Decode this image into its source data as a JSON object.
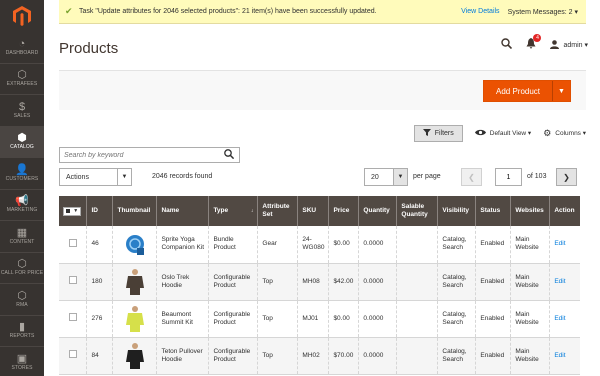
{
  "sidebar": {
    "items": [
      {
        "label": "DASHBOARD",
        "icon": "dashboard-icon",
        "glyph": "◔"
      },
      {
        "label": "EXTRAFEES",
        "icon": "extrafees-icon",
        "glyph": "⬡"
      },
      {
        "label": "SALES",
        "icon": "dollar-icon",
        "glyph": "$"
      },
      {
        "label": "CATALOG",
        "icon": "catalog-cube-icon",
        "glyph": "⬢"
      },
      {
        "label": "CUSTOMERS",
        "icon": "customer-icon",
        "glyph": "👤"
      },
      {
        "label": "MARKETING",
        "icon": "megaphone-icon",
        "glyph": "📢"
      },
      {
        "label": "CONTENT",
        "icon": "content-icon",
        "glyph": "▦"
      },
      {
        "label": "CALL FOR PRICE",
        "icon": "call-for-price-icon",
        "glyph": "⬡"
      },
      {
        "label": "RMA",
        "icon": "rma-icon",
        "glyph": "⬡"
      },
      {
        "label": "REPORTS",
        "icon": "reports-icon",
        "glyph": "▮"
      },
      {
        "label": "STORES",
        "icon": "stores-icon",
        "glyph": "▣"
      }
    ]
  },
  "message": {
    "text": "Task \"Update attributes for 2046 selected products\": 21 item(s) have been successfully updated.",
    "view_details": "View Details",
    "system_messages": "System Messages: 2 ▾"
  },
  "header": {
    "title": "Products",
    "notifications_count": "4",
    "user": "admin ▾"
  },
  "add_product": {
    "label": "Add Product"
  },
  "toolbar": {
    "filters": "Filters",
    "default_view": "Default View ▾",
    "columns": "Columns ▾"
  },
  "search": {
    "placeholder": "Search by keyword"
  },
  "controls": {
    "actions": "Actions",
    "records": "2046 records found",
    "per_page_value": "20",
    "per_page_label": "per page",
    "current_page": "1",
    "of_pages": "of 103"
  },
  "table": {
    "headers": [
      "ID",
      "Thumbnail",
      "Name",
      "Type",
      "Attribute Set",
      "SKU",
      "Price",
      "Quantity",
      "Salable Quantity",
      "Visibility",
      "Status",
      "Websites",
      "Action"
    ],
    "type_sort_glyph": "↓",
    "rows": [
      {
        "id": "46",
        "thumb": "ball",
        "name": "Sprite Yoga Companion Kit",
        "type": "Bundle Product",
        "attr_set": "Gear",
        "sku": "24-WG080",
        "price": "$0.00",
        "qty": "0.0000",
        "salable": "",
        "visibility": "Catalog, Search",
        "status": "Enabled",
        "websites": "Main Website",
        "action": "Edit"
      },
      {
        "id": "180",
        "thumb": "hoodie-dark",
        "name": "Oslo Trek Hoodie",
        "type": "Configurable Product",
        "attr_set": "Top",
        "sku": "MH08",
        "price": "$42.00",
        "qty": "0.0000",
        "salable": "",
        "visibility": "Catalog, Search",
        "status": "Enabled",
        "websites": "Main Website",
        "action": "Edit"
      },
      {
        "id": "276",
        "thumb": "shirt-yellow",
        "name": "Beaumont Summit Kit",
        "type": "Configurable Product",
        "attr_set": "Top",
        "sku": "MJ01",
        "price": "$0.00",
        "qty": "0.0000",
        "salable": "",
        "visibility": "Catalog, Search",
        "status": "Enabled",
        "websites": "Main Website",
        "action": "Edit"
      },
      {
        "id": "84",
        "thumb": "hoodie-black",
        "name": "Teton Pullover Hoodie",
        "type": "Configurable Product",
        "attr_set": "Top",
        "sku": "MH02",
        "price": "$70.00",
        "qty": "0.0000",
        "salable": "",
        "visibility": "Catalog, Search",
        "status": "Enabled",
        "websites": "Main Website",
        "action": "Edit"
      }
    ]
  },
  "colors": {
    "sidebar_bg": "#373330",
    "accent_orange": "#eb5202",
    "link_blue": "#007bdb",
    "table_header": "#514943",
    "message_bg": "#fffbbb"
  }
}
